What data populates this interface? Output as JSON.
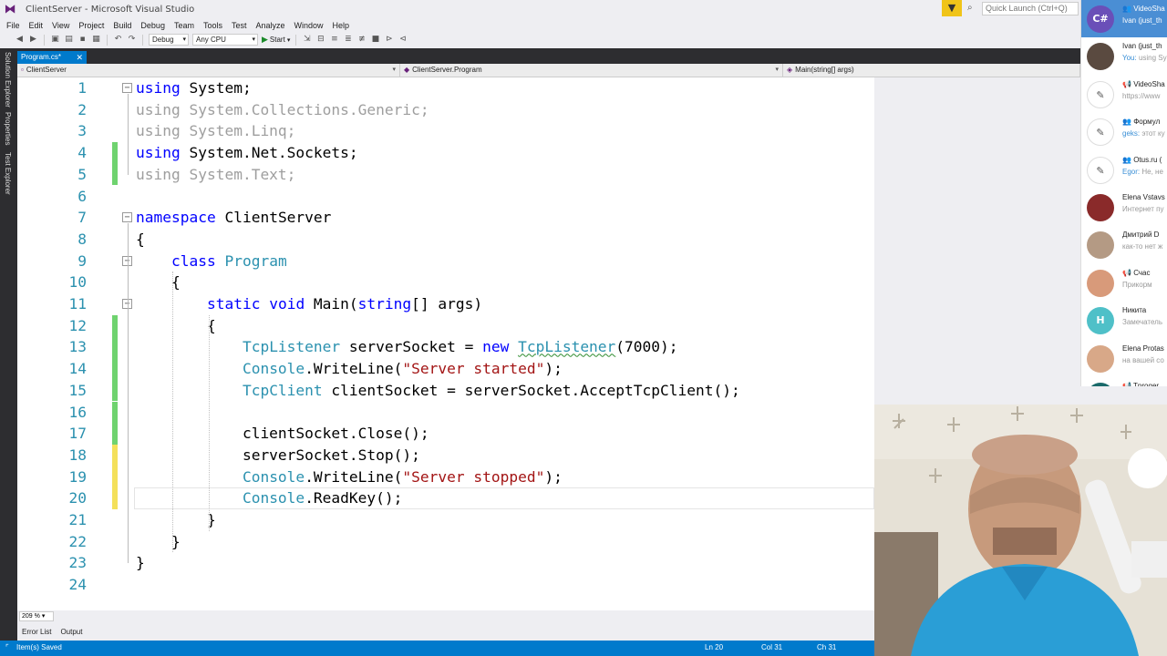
{
  "window": {
    "title": "ClientServer - Microsoft Visual Studio",
    "quick_launch_placeholder": "Quick Launch (Ctrl+Q)"
  },
  "menu": [
    "File",
    "Edit",
    "View",
    "Project",
    "Build",
    "Debug",
    "Team",
    "Tools",
    "Test",
    "Analyze",
    "Window",
    "Help"
  ],
  "toolbar": {
    "config": "Debug",
    "platform": "Any CPU",
    "start_label": "Start"
  },
  "side_tabs": [
    "Solution Explorer",
    "Properties",
    "Test Explorer"
  ],
  "document_tab": {
    "label": "Program.cs*"
  },
  "navigation": {
    "project": "ClientServer",
    "class": "ClientServer.Program",
    "member": "Main(string[] args)"
  },
  "code_lines": [
    {
      "n": "1",
      "text": "using System;"
    },
    {
      "n": "2",
      "text": "using System.Collections.Generic;"
    },
    {
      "n": "3",
      "text": "using System.Linq;"
    },
    {
      "n": "4",
      "text": "using System.Net.Sockets;"
    },
    {
      "n": "5",
      "text": "using System.Text;"
    },
    {
      "n": "6",
      "text": ""
    },
    {
      "n": "7",
      "text": "namespace ClientServer"
    },
    {
      "n": "8",
      "text": "{"
    },
    {
      "n": "9",
      "text": "    class Program"
    },
    {
      "n": "10",
      "text": "    {"
    },
    {
      "n": "11",
      "text": "        static void Main(string[] args)"
    },
    {
      "n": "12",
      "text": "        {"
    },
    {
      "n": "13",
      "text": "            TcpListener serverSocket = new TcpListener(7000);"
    },
    {
      "n": "14",
      "text": "            Console.WriteLine(\"Server started\");"
    },
    {
      "n": "15",
      "text": "            TcpClient clientSocket = serverSocket.AcceptTcpClient();"
    },
    {
      "n": "16",
      "text": ""
    },
    {
      "n": "17",
      "text": "            clientSocket.Close();"
    },
    {
      "n": "18",
      "text": "            serverSocket.Stop();"
    },
    {
      "n": "19",
      "text": "            Console.WriteLine(\"Server stopped\");"
    },
    {
      "n": "20",
      "text": "            Console.ReadKey();"
    },
    {
      "n": "21",
      "text": "        }"
    },
    {
      "n": "22",
      "text": "    }"
    },
    {
      "n": "23",
      "text": "}"
    },
    {
      "n": "24",
      "text": ""
    }
  ],
  "zoom": "209 %",
  "bottom_tabs": [
    "Error List",
    "Output"
  ],
  "status": {
    "message": "Item(s) Saved",
    "line": "Ln 20",
    "col": "Col 31",
    "ch": "Ch 31"
  },
  "chats": [
    {
      "name": "VideoSha",
      "sender": "",
      "preview": "Ivan (just_th",
      "avatar_text": "C#",
      "avatar_color": "#6a4fb8",
      "active": true,
      "group_icon": "group-icon"
    },
    {
      "name": "Ivan (just_th",
      "sender": "You:",
      "preview": " using Sy",
      "avatar_text": "",
      "avatar_color": "#5a4a40",
      "active": false,
      "group_icon": ""
    },
    {
      "name": "VideoSha",
      "sender": "",
      "preview": "https://www",
      "avatar_text": "",
      "avatar_color": "#ffffff",
      "active": false,
      "group_icon": "megaphone-icon"
    },
    {
      "name": "Формул",
      "sender": "geks:",
      "preview": " этот ку",
      "avatar_text": "",
      "avatar_color": "#ffffff",
      "active": false,
      "group_icon": "group-icon"
    },
    {
      "name": "Otus.ru (",
      "sender": "Egor:",
      "preview": " Не, не",
      "avatar_text": "",
      "avatar_color": "#ffffff",
      "active": false,
      "group_icon": "group-icon"
    },
    {
      "name": "Elena Vstavs",
      "sender": "",
      "preview": "Интернет пу",
      "avatar_text": "",
      "avatar_color": "#8a2a2a",
      "active": false,
      "group_icon": ""
    },
    {
      "name": "Дмитрий D",
      "sender": "",
      "preview": "как-то нет ж",
      "avatar_text": "",
      "avatar_color": "#b49a84",
      "active": false,
      "group_icon": ""
    },
    {
      "name": "Счас",
      "sender": "",
      "preview": "Прикорм",
      "avatar_text": "",
      "avatar_color": "#d89a7a",
      "active": false,
      "group_icon": "megaphone-icon"
    },
    {
      "name": "Никита",
      "sender": "",
      "preview": "Замечатель",
      "avatar_text": "Н",
      "avatar_color": "#4fc0c8",
      "active": false,
      "group_icon": ""
    },
    {
      "name": "Elena Protas",
      "sender": "",
      "preview": "на вашей со",
      "avatar_text": "",
      "avatar_color": "#d8a888",
      "active": false,
      "group_icon": ""
    },
    {
      "name": "Tproger",
      "sender": "",
      "preview": "",
      "avatar_text": "",
      "avatar_color": "#1a6a6a",
      "active": false,
      "group_icon": "megaphone-icon"
    }
  ],
  "colors": {
    "accent": "#007acc",
    "keyword": "#0000ff",
    "type": "#2b91af",
    "string": "#a31515",
    "changed_saved": "#6fd36f",
    "changed_unsaved": "#f4e05a",
    "telegram_active": "#4a8ed4"
  },
  "webcam": {
    "description_icon": "webcam-feed"
  }
}
